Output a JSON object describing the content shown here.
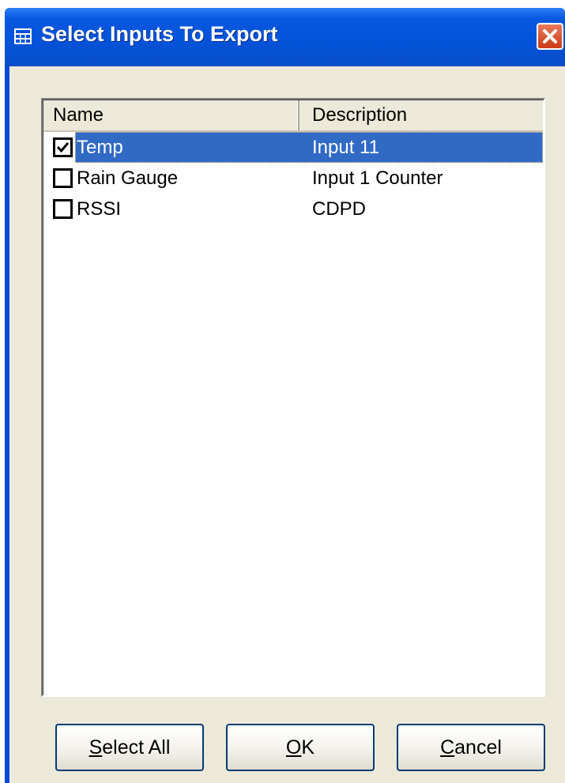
{
  "window": {
    "title": "Select Inputs To Export",
    "title_icon": "table-icon",
    "close_icon": "close-icon"
  },
  "list": {
    "columns": [
      "Name",
      "Description"
    ],
    "rows": [
      {
        "checked": true,
        "selected": true,
        "name": "Temp",
        "description": "Input 11"
      },
      {
        "checked": false,
        "selected": false,
        "name": "Rain Gauge",
        "description": "Input 1 Counter"
      },
      {
        "checked": false,
        "selected": false,
        "name": "RSSI",
        "description": "CDPD"
      }
    ]
  },
  "buttons": {
    "select_all": {
      "mnemonic": "S",
      "rest": "elect All"
    },
    "ok": {
      "mnemonic": "O",
      "rest": "K"
    },
    "cancel": {
      "mnemonic": "C",
      "rest": "ancel"
    }
  },
  "colors": {
    "titlebar": "#0352d8",
    "selection": "#316ac5",
    "dialog_bg": "#ece9d8"
  }
}
